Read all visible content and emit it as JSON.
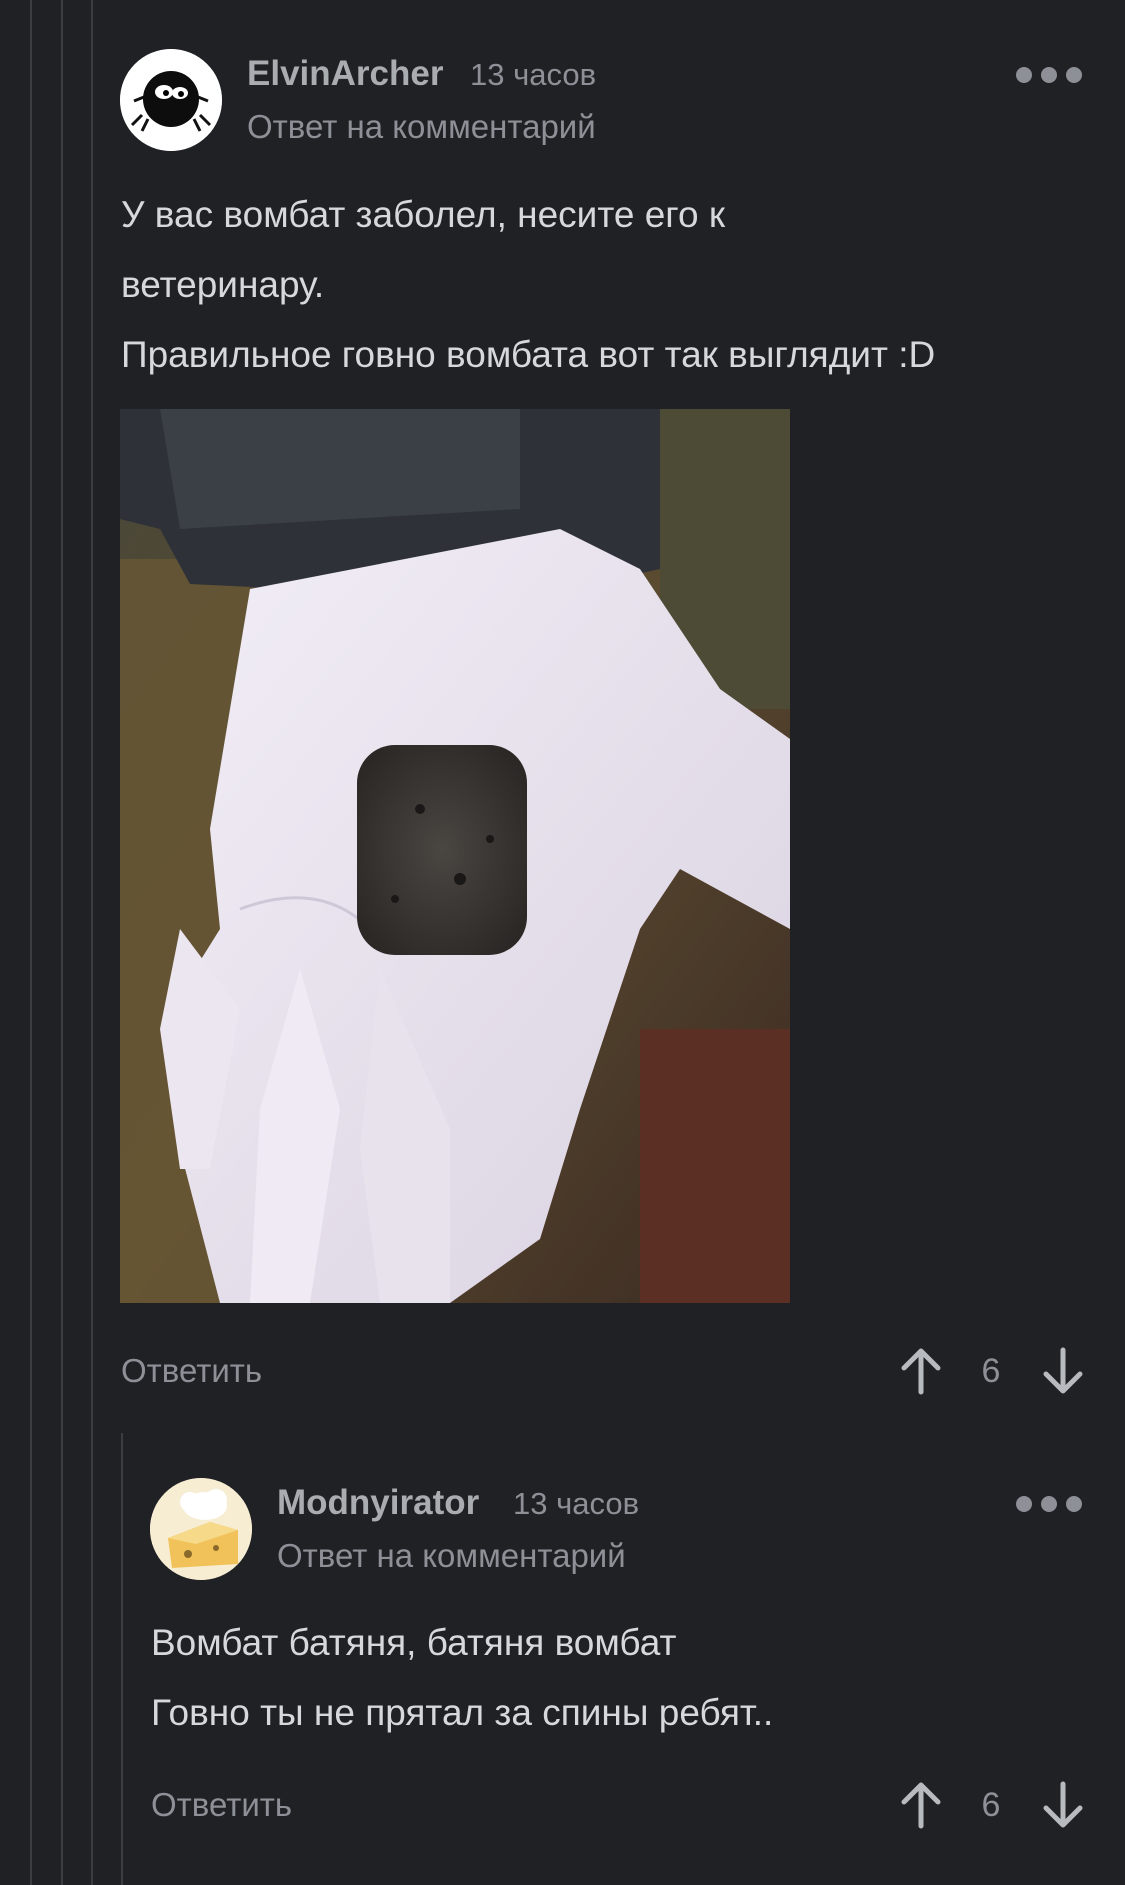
{
  "comments": [
    {
      "author": "ElvinArcher",
      "time": "13 часов",
      "reply_to": "Ответ на комментарий",
      "lines": [
        "У вас вомбат заболел, несите его к",
        "ветеринару.",
        "Правильное говно вомбата вот так выглядит :D"
      ],
      "reply_label": "Ответить",
      "rating": "6"
    },
    {
      "author": "Modnyirator",
      "time": "13 часов",
      "reply_to": "Ответ на комментарий",
      "lines": [
        "Вомбат батяня, батяня вомбат",
        "Говно ты не прятал за спины ребят.."
      ],
      "reply_label": "Ответить",
      "rating": "6"
    }
  ],
  "icons": {
    "more": "more-dots-icon",
    "upvote": "arrow-up-icon",
    "downvote": "arrow-down-icon"
  },
  "colors": {
    "background": "#1f2125",
    "text": "#d6d8db",
    "muted": "#8d9096",
    "thread_line": "#3a3d42"
  }
}
